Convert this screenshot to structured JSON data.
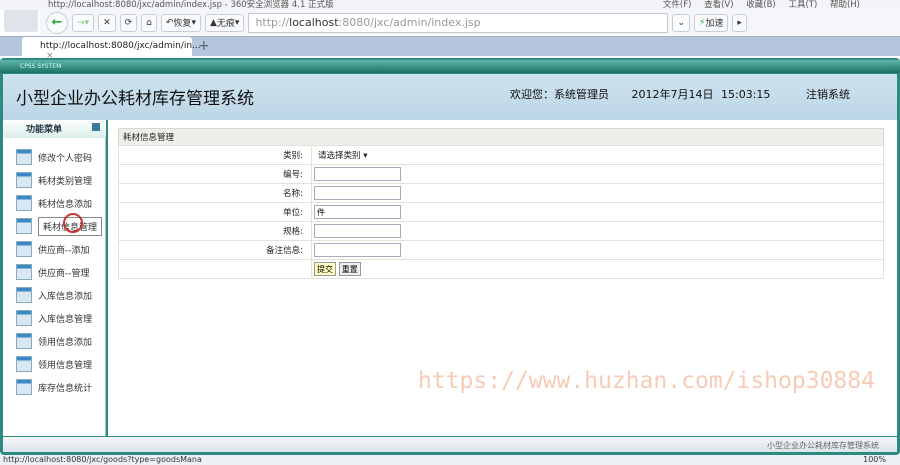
{
  "browser": {
    "window_title": "http://localhost:8080/jxc/admin/index.jsp - 360安全浏览器 4.1 正式版",
    "menu": [
      "文件(F)",
      "查看(V)",
      "收藏(B)",
      "工具(T)",
      "帮助(H)"
    ],
    "restore_label": "恢复",
    "incognito_label": "无痕",
    "url_prefix": "http://",
    "url_host": "localhost",
    "url_rest": ":8080/jxc/admin/index.jsp",
    "speed_label": "加速",
    "tab_title": "http://localhost:8080/jxc/admin/in...",
    "status_url": "http://localhost:8080/jxc/goods?type=goodsMana",
    "zoom": "100%"
  },
  "app": {
    "frame_label": "CPSS SYSTEM",
    "title": "小型企业办公耗材库存管理系统",
    "welcome": "欢迎您：系统管理员",
    "datetime": "2012年7月14日  15:03:15",
    "logout": "注销系统",
    "footer": "小型企业办公耗材库存管理系统"
  },
  "sidebar": {
    "header": "功能菜单",
    "items": [
      "修改个人密码",
      "耗材类别管理",
      "耗材信息添加",
      "耗材信息管理",
      "供应商--添加",
      "供应商--管理",
      "入库信息添加",
      "入库信息管理",
      "领用信息添加",
      "领用信息管理",
      "库存信息统计"
    ]
  },
  "form": {
    "title": "耗材信息管理",
    "category_label": "类别:",
    "category_value": "请选择类别",
    "code_label": "编号:",
    "code_value": "",
    "name_label": "名称:",
    "name_value": "",
    "unit_label": "单位:",
    "unit_value": "件",
    "spec_label": "规格:",
    "spec_value": "",
    "remark_label": "备注信息:",
    "remark_value": "",
    "submit": "提交",
    "reset": "重置"
  },
  "watermark": "https://www.huzhan.com/ishop30884"
}
